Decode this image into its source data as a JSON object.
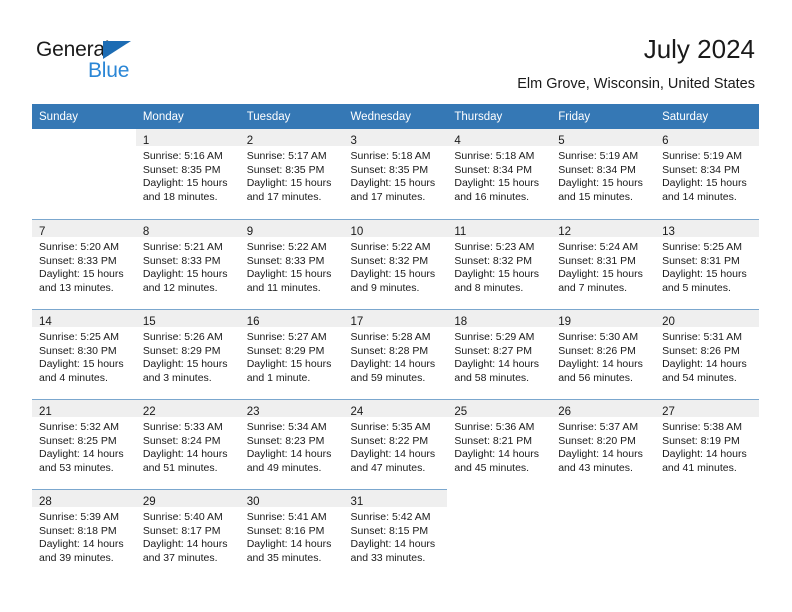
{
  "brand": {
    "name_part1": "General",
    "name_part2": "Blue",
    "accent_color": "#2a86d6",
    "triangle_color": "#1d6cb3"
  },
  "header": {
    "title": "July 2024",
    "subtitle": "Elm Grove, Wisconsin, United States",
    "header_bg_color": "#3578b5"
  },
  "weekday_headers": [
    "Sunday",
    "Monday",
    "Tuesday",
    "Wednesday",
    "Thursday",
    "Friday",
    "Saturday"
  ],
  "weeks": [
    [
      {
        "day": "",
        "sunrise": "",
        "sunset": "",
        "daylight1": "",
        "daylight2": "",
        "empty": true
      },
      {
        "day": "1",
        "sunrise": "Sunrise: 5:16 AM",
        "sunset": "Sunset: 8:35 PM",
        "daylight1": "Daylight: 15 hours",
        "daylight2": "and 18 minutes.",
        "empty": false
      },
      {
        "day": "2",
        "sunrise": "Sunrise: 5:17 AM",
        "sunset": "Sunset: 8:35 PM",
        "daylight1": "Daylight: 15 hours",
        "daylight2": "and 17 minutes.",
        "empty": false
      },
      {
        "day": "3",
        "sunrise": "Sunrise: 5:18 AM",
        "sunset": "Sunset: 8:35 PM",
        "daylight1": "Daylight: 15 hours",
        "daylight2": "and 17 minutes.",
        "empty": false
      },
      {
        "day": "4",
        "sunrise": "Sunrise: 5:18 AM",
        "sunset": "Sunset: 8:34 PM",
        "daylight1": "Daylight: 15 hours",
        "daylight2": "and 16 minutes.",
        "empty": false
      },
      {
        "day": "5",
        "sunrise": "Sunrise: 5:19 AM",
        "sunset": "Sunset: 8:34 PM",
        "daylight1": "Daylight: 15 hours",
        "daylight2": "and 15 minutes.",
        "empty": false
      },
      {
        "day": "6",
        "sunrise": "Sunrise: 5:19 AM",
        "sunset": "Sunset: 8:34 PM",
        "daylight1": "Daylight: 15 hours",
        "daylight2": "and 14 minutes.",
        "empty": false
      }
    ],
    [
      {
        "day": "7",
        "sunrise": "Sunrise: 5:20 AM",
        "sunset": "Sunset: 8:33 PM",
        "daylight1": "Daylight: 15 hours",
        "daylight2": "and 13 minutes.",
        "empty": false
      },
      {
        "day": "8",
        "sunrise": "Sunrise: 5:21 AM",
        "sunset": "Sunset: 8:33 PM",
        "daylight1": "Daylight: 15 hours",
        "daylight2": "and 12 minutes.",
        "empty": false
      },
      {
        "day": "9",
        "sunrise": "Sunrise: 5:22 AM",
        "sunset": "Sunset: 8:33 PM",
        "daylight1": "Daylight: 15 hours",
        "daylight2": "and 11 minutes.",
        "empty": false
      },
      {
        "day": "10",
        "sunrise": "Sunrise: 5:22 AM",
        "sunset": "Sunset: 8:32 PM",
        "daylight1": "Daylight: 15 hours",
        "daylight2": "and 9 minutes.",
        "empty": false
      },
      {
        "day": "11",
        "sunrise": "Sunrise: 5:23 AM",
        "sunset": "Sunset: 8:32 PM",
        "daylight1": "Daylight: 15 hours",
        "daylight2": "and 8 minutes.",
        "empty": false
      },
      {
        "day": "12",
        "sunrise": "Sunrise: 5:24 AM",
        "sunset": "Sunset: 8:31 PM",
        "daylight1": "Daylight: 15 hours",
        "daylight2": "and 7 minutes.",
        "empty": false
      },
      {
        "day": "13",
        "sunrise": "Sunrise: 5:25 AM",
        "sunset": "Sunset: 8:31 PM",
        "daylight1": "Daylight: 15 hours",
        "daylight2": "and 5 minutes.",
        "empty": false
      }
    ],
    [
      {
        "day": "14",
        "sunrise": "Sunrise: 5:25 AM",
        "sunset": "Sunset: 8:30 PM",
        "daylight1": "Daylight: 15 hours",
        "daylight2": "and 4 minutes.",
        "empty": false
      },
      {
        "day": "15",
        "sunrise": "Sunrise: 5:26 AM",
        "sunset": "Sunset: 8:29 PM",
        "daylight1": "Daylight: 15 hours",
        "daylight2": "and 3 minutes.",
        "empty": false
      },
      {
        "day": "16",
        "sunrise": "Sunrise: 5:27 AM",
        "sunset": "Sunset: 8:29 PM",
        "daylight1": "Daylight: 15 hours",
        "daylight2": "and 1 minute.",
        "empty": false
      },
      {
        "day": "17",
        "sunrise": "Sunrise: 5:28 AM",
        "sunset": "Sunset: 8:28 PM",
        "daylight1": "Daylight: 14 hours",
        "daylight2": "and 59 minutes.",
        "empty": false
      },
      {
        "day": "18",
        "sunrise": "Sunrise: 5:29 AM",
        "sunset": "Sunset: 8:27 PM",
        "daylight1": "Daylight: 14 hours",
        "daylight2": "and 58 minutes.",
        "empty": false
      },
      {
        "day": "19",
        "sunrise": "Sunrise: 5:30 AM",
        "sunset": "Sunset: 8:26 PM",
        "daylight1": "Daylight: 14 hours",
        "daylight2": "and 56 minutes.",
        "empty": false
      },
      {
        "day": "20",
        "sunrise": "Sunrise: 5:31 AM",
        "sunset": "Sunset: 8:26 PM",
        "daylight1": "Daylight: 14 hours",
        "daylight2": "and 54 minutes.",
        "empty": false
      }
    ],
    [
      {
        "day": "21",
        "sunrise": "Sunrise: 5:32 AM",
        "sunset": "Sunset: 8:25 PM",
        "daylight1": "Daylight: 14 hours",
        "daylight2": "and 53 minutes.",
        "empty": false
      },
      {
        "day": "22",
        "sunrise": "Sunrise: 5:33 AM",
        "sunset": "Sunset: 8:24 PM",
        "daylight1": "Daylight: 14 hours",
        "daylight2": "and 51 minutes.",
        "empty": false
      },
      {
        "day": "23",
        "sunrise": "Sunrise: 5:34 AM",
        "sunset": "Sunset: 8:23 PM",
        "daylight1": "Daylight: 14 hours",
        "daylight2": "and 49 minutes.",
        "empty": false
      },
      {
        "day": "24",
        "sunrise": "Sunrise: 5:35 AM",
        "sunset": "Sunset: 8:22 PM",
        "daylight1": "Daylight: 14 hours",
        "daylight2": "and 47 minutes.",
        "empty": false
      },
      {
        "day": "25",
        "sunrise": "Sunrise: 5:36 AM",
        "sunset": "Sunset: 8:21 PM",
        "daylight1": "Daylight: 14 hours",
        "daylight2": "and 45 minutes.",
        "empty": false
      },
      {
        "day": "26",
        "sunrise": "Sunrise: 5:37 AM",
        "sunset": "Sunset: 8:20 PM",
        "daylight1": "Daylight: 14 hours",
        "daylight2": "and 43 minutes.",
        "empty": false
      },
      {
        "day": "27",
        "sunrise": "Sunrise: 5:38 AM",
        "sunset": "Sunset: 8:19 PM",
        "daylight1": "Daylight: 14 hours",
        "daylight2": "and 41 minutes.",
        "empty": false
      }
    ],
    [
      {
        "day": "28",
        "sunrise": "Sunrise: 5:39 AM",
        "sunset": "Sunset: 8:18 PM",
        "daylight1": "Daylight: 14 hours",
        "daylight2": "and 39 minutes.",
        "empty": false
      },
      {
        "day": "29",
        "sunrise": "Sunrise: 5:40 AM",
        "sunset": "Sunset: 8:17 PM",
        "daylight1": "Daylight: 14 hours",
        "daylight2": "and 37 minutes.",
        "empty": false
      },
      {
        "day": "30",
        "sunrise": "Sunrise: 5:41 AM",
        "sunset": "Sunset: 8:16 PM",
        "daylight1": "Daylight: 14 hours",
        "daylight2": "and 35 minutes.",
        "empty": false
      },
      {
        "day": "31",
        "sunrise": "Sunrise: 5:42 AM",
        "sunset": "Sunset: 8:15 PM",
        "daylight1": "Daylight: 14 hours",
        "daylight2": "and 33 minutes.",
        "empty": false
      },
      {
        "day": "",
        "sunrise": "",
        "sunset": "",
        "daylight1": "",
        "daylight2": "",
        "empty": true
      },
      {
        "day": "",
        "sunrise": "",
        "sunset": "",
        "daylight1": "",
        "daylight2": "",
        "empty": true
      },
      {
        "day": "",
        "sunrise": "",
        "sunset": "",
        "daylight1": "",
        "daylight2": "",
        "empty": true
      }
    ]
  ]
}
